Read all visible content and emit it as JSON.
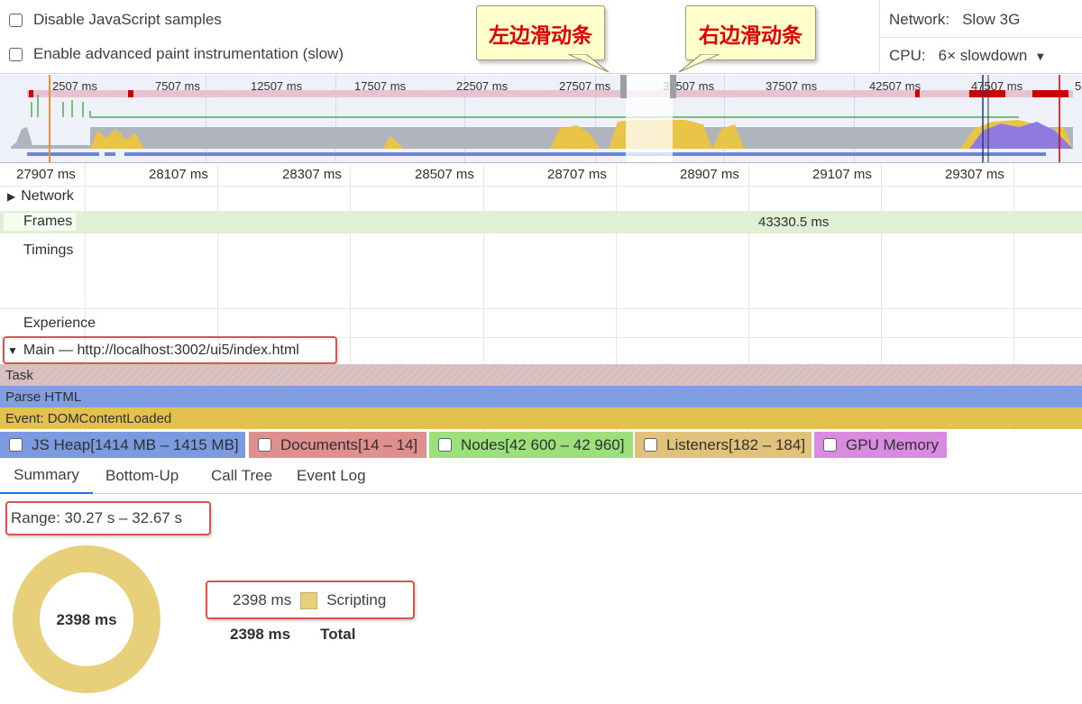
{
  "settings": {
    "disable_js_samples": "Disable JavaScript samples",
    "advanced_paint": "Enable advanced paint instrumentation (slow)",
    "network_label": "Network:",
    "network_value": "Slow 3G",
    "cpu_label": "CPU:",
    "cpu_value": "6× slowdown"
  },
  "callouts": {
    "left": "左边滑动条",
    "right": "右边滑动条"
  },
  "overview": {
    "ticks": [
      "2507 ms",
      "7507 ms",
      "12507 ms",
      "17507 ms",
      "22507 ms",
      "27507 ms",
      "32507 ms",
      "37507 ms",
      "42507 ms",
      "47507 ms",
      "5"
    ]
  },
  "timeline": {
    "ticks": [
      "27907 ms",
      "28107 ms",
      "28307 ms",
      "28507 ms",
      "28707 ms",
      "28907 ms",
      "29107 ms",
      "29307 ms"
    ],
    "tracks": {
      "network": "Network",
      "frames": "Frames",
      "frames_value": "43330.5 ms",
      "timings": "Timings",
      "experience": "Experience",
      "main": "Main — http://localhost:3002/ui5/index.html"
    },
    "bars": {
      "task": "Task",
      "parse_html": "Parse HTML",
      "event": "Event: DOMContentLoaded"
    }
  },
  "counters": [
    {
      "label": "JS Heap[1414 MB – 1415 MB]",
      "color": "#7b9ae0"
    },
    {
      "label": "Documents[14 – 14]",
      "color": "#e08f8f"
    },
    {
      "label": "Nodes[42 600 – 42 960]",
      "color": "#9be07b"
    },
    {
      "label": "Listeners[182 – 184]",
      "color": "#e0c27b"
    },
    {
      "label": "GPU Memory",
      "color": "#d98be0"
    }
  ],
  "tabs": [
    "Summary",
    "Bottom-Up",
    "Call Tree",
    "Event Log"
  ],
  "summary": {
    "range": "Range: 30.27 s – 32.67 s",
    "donut_center": "2398 ms",
    "legend_value": "2398 ms",
    "legend_label": "Scripting",
    "total_value": "2398 ms",
    "total_label": "Total",
    "scripting_color": "#e8cf7a"
  }
}
